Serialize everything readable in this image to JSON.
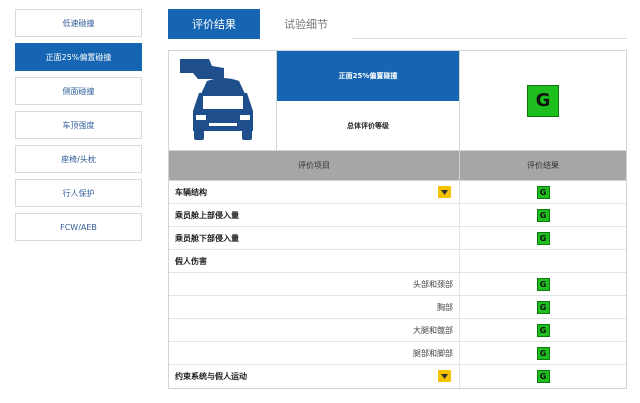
{
  "sidebar": {
    "items": [
      {
        "label": "低速碰撞",
        "active": false
      },
      {
        "label": "正面25%偏置碰撞",
        "active": true
      },
      {
        "label": "侧面碰撞",
        "active": false
      },
      {
        "label": "车顶强度",
        "active": false
      },
      {
        "label": "座椅/头枕",
        "active": false
      },
      {
        "label": "行人保护",
        "active": false
      },
      {
        "label": "FCW/AEB",
        "active": false
      }
    ]
  },
  "tabs": {
    "active_label": "评价结果",
    "inactive_label": "试验细节"
  },
  "summary": {
    "test_name": "正面25%偏置碰撞",
    "overall_label": "总体评价等级",
    "overall_rating": "G",
    "image_icon": "car-crash-icon"
  },
  "table": {
    "header_item": "评价项目",
    "header_result": "评价结果",
    "rows": [
      {
        "label": "车辆结构",
        "rating": "G",
        "has_dropdown": true
      },
      {
        "label": "乘员舱上部侵入量",
        "rating": "G",
        "has_dropdown": false
      },
      {
        "label": "乘员舱下部侵入量",
        "rating": "G",
        "has_dropdown": false
      },
      {
        "label": "假人伤害",
        "rating": "",
        "has_dropdown": false
      },
      {
        "label": "头部和颈部",
        "rating": "G",
        "has_dropdown": false
      },
      {
        "label": "胸部",
        "rating": "G",
        "has_dropdown": false
      },
      {
        "label": "大腿和髋部",
        "rating": "G",
        "has_dropdown": false
      },
      {
        "label": "腿部和脚部",
        "rating": "G",
        "has_dropdown": false
      },
      {
        "label": "约束系统与假人运动",
        "rating": "G",
        "has_dropdown": true
      }
    ]
  },
  "colors": {
    "accent_blue": "#1565b3",
    "rating_green": "#1fbe1f",
    "dropdown_yellow": "#f5c400",
    "header_gray": "#a6a6a6"
  }
}
